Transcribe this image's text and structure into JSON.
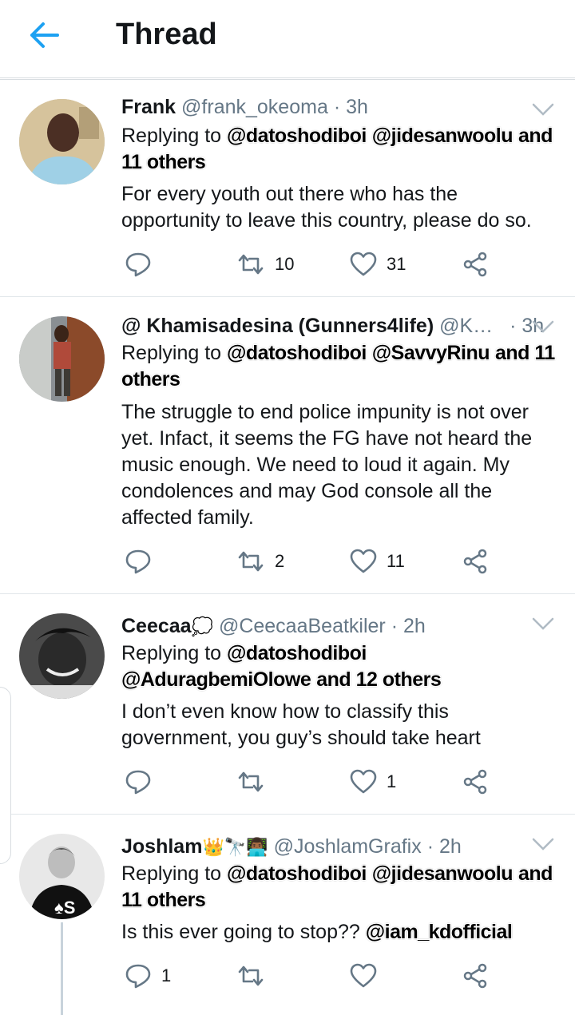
{
  "header": {
    "title": "Thread",
    "back_icon": "arrow-left-icon",
    "accent": "#1da1f2"
  },
  "tweets": [
    {
      "name": "Frank",
      "handle": "@frank_okeoma",
      "time": "· 3h",
      "replying_label": "Replying to",
      "mentions": [
        "@datoshodiboi",
        "@jidesanwoolu",
        "and"
      ],
      "mentions_extra": "11 others",
      "text": "For every youth out there who has the opportunity to leave this country, please do so.",
      "retweets": "10",
      "likes": "31"
    },
    {
      "name": "@ Khamisadesina (Gunners4life)",
      "handle": "@K…",
      "time": "· 3h",
      "replying_label": "Replying to",
      "mentions": [
        "@datoshodiboi",
        "@SavvyRinu",
        "and 11"
      ],
      "mentions_extra": "others",
      "text": "The struggle to end police impunity is not over yet. Infact, it seems the FG have not heard the music enough. We need to loud it again. My condolences and may God console all the affected family.",
      "retweets": "2",
      "likes": "11"
    },
    {
      "name": "Ceecaa",
      "name_emoji": "💭",
      "handle": "@CeecaaBeatkiler",
      "time": "· 2h",
      "replying_label": "Replying to",
      "mentions": [
        "@datoshodiboi",
        "@AduragbemiOlowe"
      ],
      "mentions_extra": "and 12 others",
      "text": "I don’t even know how to classify this government, you guy’s should take heart",
      "likes": "1"
    },
    {
      "name": "Joshlam",
      "name_emoji": "👑🔭👨🏾‍💻",
      "handle": "@JoshlamGrafix",
      "time": "· 2h",
      "replying_label": "Replying to",
      "mentions": [
        "@datoshodiboi",
        "@jidesanwoolu",
        "and"
      ],
      "mentions_extra": "11 others",
      "text": "Is this ever going to stop??",
      "text_mention": "@iam_kdofficial",
      "replies": "1"
    }
  ],
  "icons": {
    "reply": "reply-icon",
    "retweet": "retweet-icon",
    "like": "heart-icon",
    "share": "share-icon",
    "menu": "chevron-down-icon"
  },
  "colors": {
    "icon_gray": "#657786",
    "divider": "#e1e6ea"
  }
}
